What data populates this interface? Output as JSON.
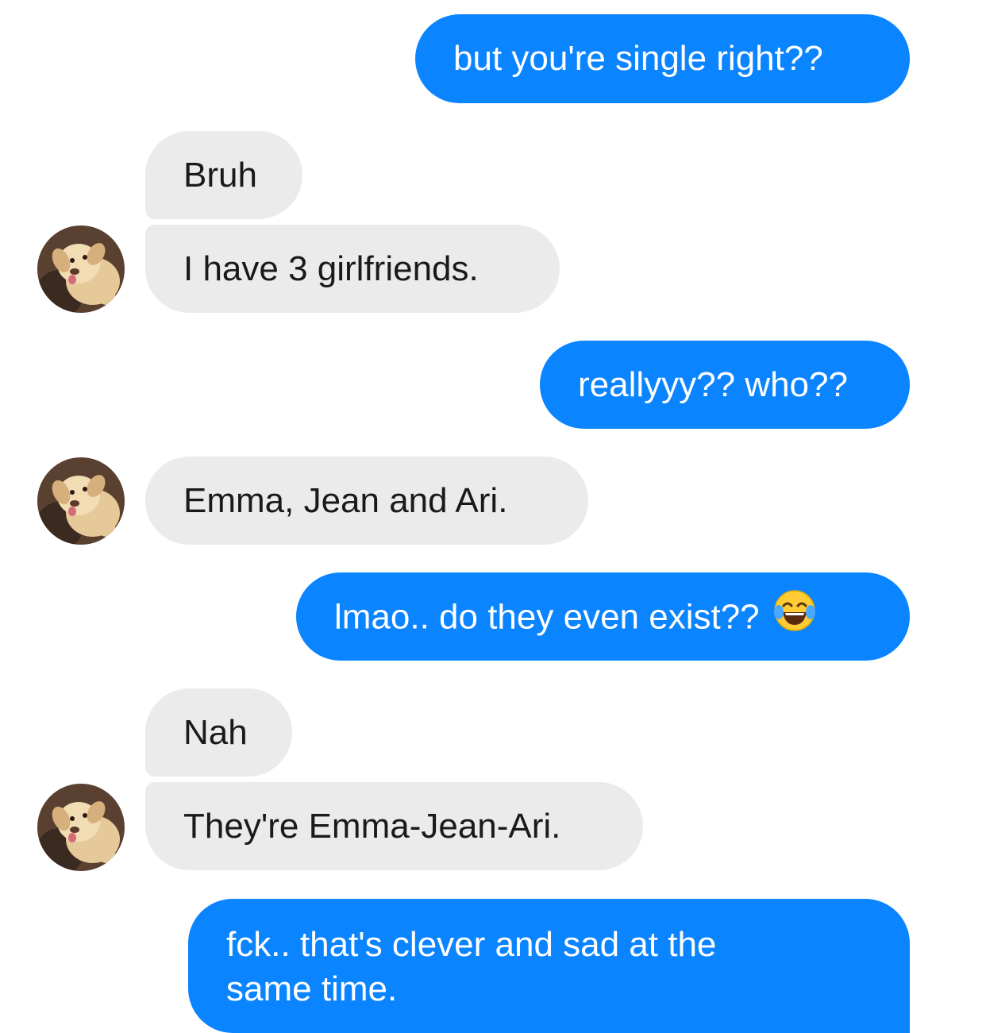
{
  "conversation": {
    "messages": [
      {
        "sender": "me",
        "text": "but you're single right??"
      },
      {
        "sender": "them",
        "text": "Bruh"
      },
      {
        "sender": "them",
        "text": "I have 3 girlfriends."
      },
      {
        "sender": "me",
        "text": "reallyyy?? who??"
      },
      {
        "sender": "them",
        "text": "Emma, Jean and Ari."
      },
      {
        "sender": "me",
        "text": "lmao.. do they even exist??",
        "emoji": "face-with-tears-of-joy-icon"
      },
      {
        "sender": "them",
        "text": "Nah"
      },
      {
        "sender": "them",
        "text": "They're Emma-Jean-Ari."
      },
      {
        "sender": "me",
        "text": "fck.. that's clever and sad at the same time."
      }
    ]
  },
  "colors": {
    "outgoing_bubble": "#0a84ff",
    "incoming_bubble": "#ebebeb",
    "background": "#ffffff"
  },
  "avatar": {
    "icon": "dog-avatar-icon"
  }
}
